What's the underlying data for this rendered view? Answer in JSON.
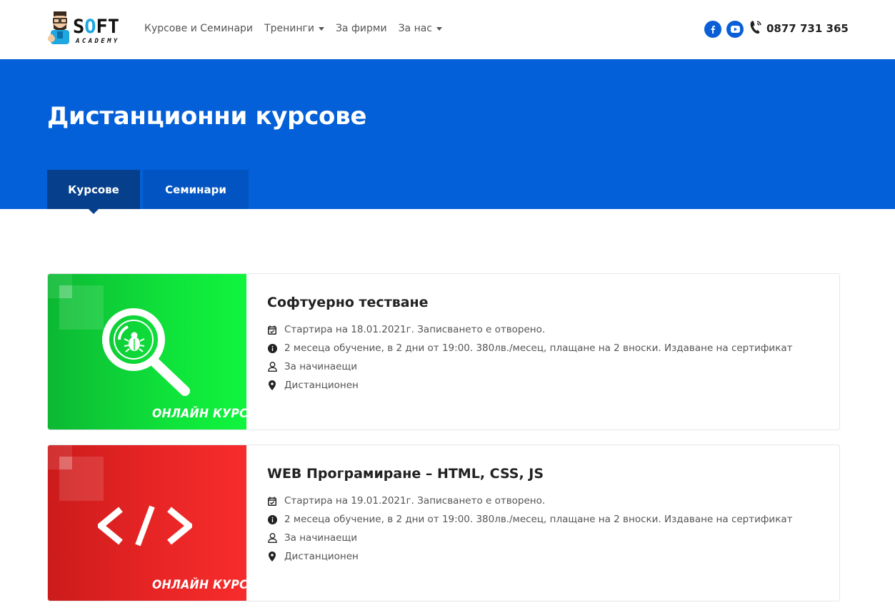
{
  "header": {
    "logo": {
      "text_main": "SOFT",
      "text_sub": "ACADEMY"
    },
    "nav": [
      {
        "label": "Курсове и Семинари",
        "has_dropdown": false
      },
      {
        "label": "Тренинги",
        "has_dropdown": true
      },
      {
        "label": "За фирми",
        "has_dropdown": false
      },
      {
        "label": "За нас",
        "has_dropdown": true
      }
    ],
    "social": [
      "facebook-icon",
      "youtube-icon"
    ],
    "phone": "0877 731 365"
  },
  "hero": {
    "title": "Дистанционни курсове",
    "tabs": [
      {
        "label": "Курсове",
        "active": true
      },
      {
        "label": "Семинари",
        "active": false
      }
    ]
  },
  "courses": [
    {
      "title": "Софтуерно тестване",
      "badge": "ОНЛАЙН КУРС",
      "theme": "green",
      "icon": "bug-magnifier-icon",
      "start": "Стартира на 18.01.2021г. Записването е отворено.",
      "details": "2 месеца обучение, в 2 дни от 19:00. 380лв./месец, плащане на 2 вноски. Издаване на сертификат",
      "level": "За начинаещи",
      "location": "Дистанционен"
    },
    {
      "title": "WEB Програмиране – HTML, CSS, JS",
      "badge": "ОНЛАЙН КУРС",
      "theme": "red",
      "icon": "code-icon",
      "start": "Стартира на 19.01.2021г. Записването е отворено.",
      "details": "2 месеца обучение, в 2 дни от 19:00. 380лв./месец, плащане на 2 вноски. Издаване на сертификат",
      "level": "За начинаещи",
      "location": "Дистанционен"
    }
  ],
  "colors": {
    "primary_blue": "#0360d8",
    "tab_active": "#063f8c",
    "tab_inactive": "#0254c2",
    "green_card": "#10f53e",
    "red_card": "#f72c2c"
  }
}
